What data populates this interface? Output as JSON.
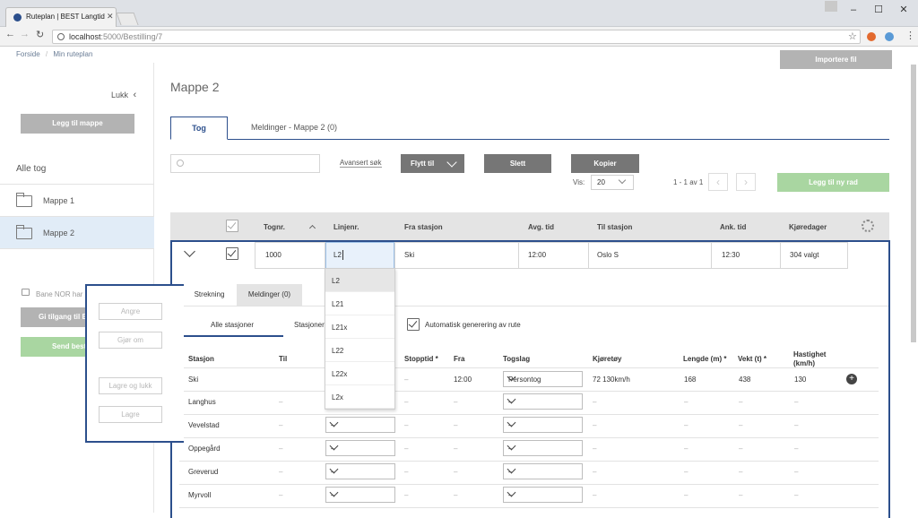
{
  "browser": {
    "tab_title": "Ruteplan | BEST Langtid",
    "url_host": "localhost",
    "url_rest": ":5000/Bestilling/7"
  },
  "breadcrumb": [
    "Forside",
    "Min ruteplan"
  ],
  "header": {
    "import_button": "Importere fil"
  },
  "sidebar": {
    "close_label": "Lukk",
    "add_folder_button": "Legg til mappe",
    "all_trains": "Alle tog",
    "folders": [
      {
        "label": "Mappe 1"
      },
      {
        "label": "Mappe 2"
      }
    ],
    "locked_text": "Bane NOR har l",
    "access_button": "Gi tilgang til B",
    "send_button": "Send best"
  },
  "main": {
    "title": "Mappe 2",
    "tabs": [
      {
        "label": "Tog"
      },
      {
        "label": "Meldinger - Mappe 2 (0)"
      }
    ],
    "advanced_search": "Avansert søk",
    "move_button": "Flytt til",
    "delete_button": "Slett",
    "copy_button": "Kopier",
    "show_label": "Vis:",
    "page_size": "20",
    "page_info": "1 - 1 av 1",
    "add_row_button": "Legg til ny rad"
  },
  "table": {
    "headers": [
      "Tognr.",
      "Linjenr.",
      "Fra stasjon",
      "Avg. tid",
      "Til stasjon",
      "Ank. tid",
      "Kjøredager"
    ],
    "row": {
      "tognr": "1000",
      "linjenr": "L2",
      "fra": "Ski",
      "avg": "12:00",
      "til": "Oslo S",
      "ank": "12:30",
      "dager": "304 valgt"
    }
  },
  "dropdown": {
    "options": [
      "L2",
      "L21",
      "L21x",
      "L22",
      "L22x",
      "L2x"
    ]
  },
  "detail": {
    "tabs": [
      {
        "label": "Strekning"
      },
      {
        "label": "Meldinger (0)"
      }
    ],
    "subtabs": [
      {
        "label": "Alle stasjoner"
      },
      {
        "label": "Stasjoner"
      }
    ],
    "auto_generate": "Automatisk generering av rute",
    "headers": [
      "Stasjon",
      "Til",
      "Stopptid *",
      "Fra",
      "Togslag",
      "Kjøretøy",
      "Lengde (m) *",
      "Vekt (t) *",
      "Hastighet",
      "(km/h)"
    ],
    "stations": [
      {
        "name": "Ski",
        "stopptid": "–",
        "fra": "12:00",
        "togslag": "Persontog",
        "kjoretoy": "72 130km/h",
        "lengde": "168",
        "vekt": "438",
        "hastighet": "130"
      },
      {
        "name": "Langhus",
        "stopptid": "–",
        "fra": "–",
        "togslag": "–",
        "kjoretoy": "–",
        "lengde": "–",
        "vekt": "–",
        "hastighet": "–"
      },
      {
        "name": "Vevelstad",
        "stopptid": "–",
        "fra": "–",
        "togslag": "–",
        "kjoretoy": "–",
        "lengde": "–",
        "vekt": "–",
        "hastighet": "–"
      },
      {
        "name": "Oppegård",
        "stopptid": "–",
        "fra": "–",
        "togslag": "–",
        "kjoretoy": "–",
        "lengde": "–",
        "vekt": "–",
        "hastighet": "–"
      },
      {
        "name": "Greverud",
        "stopptid": "–",
        "fra": "–",
        "togslag": "–",
        "kjoretoy": "–",
        "lengde": "–",
        "vekt": "–",
        "hastighet": "–"
      },
      {
        "name": "Myrvoll",
        "stopptid": "–",
        "fra": "–",
        "togslag": "–",
        "kjoretoy": "–",
        "lengde": "–",
        "vekt": "–",
        "hastighet": "–"
      }
    ],
    "row_select_value": "–"
  },
  "actions": {
    "undo": "Angre",
    "redo": "Gjør om",
    "save_close": "Lagre og lukk",
    "save": "Lagre"
  },
  "colors": {
    "navy": "#2c4f8c",
    "green": "#a9d6a1",
    "gray": "#b3b3b3",
    "dark": "#767676"
  }
}
